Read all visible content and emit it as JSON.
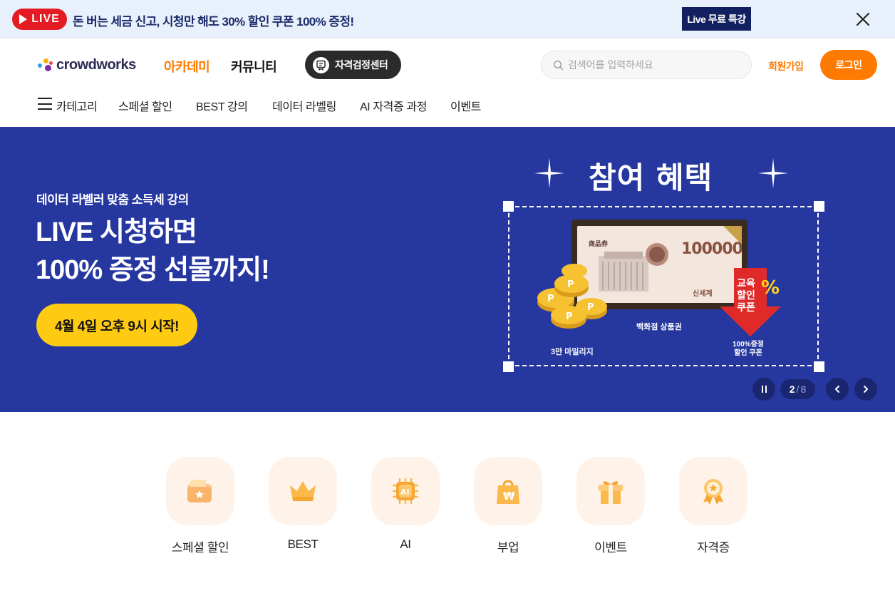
{
  "promo": {
    "live_label": "LIVE",
    "text": "돈 버는 세금 신고, 시청만 해도 30% 할인 쿠폰 100% 증정!",
    "button_label": "Live 무료 특강"
  },
  "header": {
    "logo_text": "crowdworks",
    "nav": [
      "아카데미",
      "커뮤니티"
    ],
    "cert_button_label": "자격검정센터",
    "search_placeholder": "검색어를 입력하세요",
    "signup_label": "회원가입",
    "login_label": "로그인"
  },
  "subnav": {
    "category_label": "카테고리",
    "items": [
      "스페셜 할인",
      "BEST 강의",
      "데이터 라벨링",
      "AI 자격증 과정",
      "이벤트"
    ]
  },
  "hero": {
    "subtitle": "데이터 라벨러 맞춤 소득세 강의",
    "title_line1": "LIVE 시청하면",
    "title_line2": "100% 증정 선물까지!",
    "cta_label": "4월 4일 오후 9시 시작!",
    "benefit_title": "참여 혜택",
    "voucher_label": "商品券",
    "voucher_amount": "100000",
    "voucher_brand": "신세계",
    "voucher_caption": "백화점 상품권",
    "mileage_caption": "3만 마일리지",
    "coupon_badge_line1": "교육",
    "coupon_badge_line2": "할인",
    "coupon_badge_line3": "쿠폰",
    "coupon_caption_line1": "100%증정",
    "coupon_caption_line2": "할인 쿠폰",
    "carousel_current": "2",
    "carousel_separator": "/",
    "carousel_total": "8"
  },
  "categories": [
    {
      "label": "스페셜 할인",
      "icon": "wallet-star-icon"
    },
    {
      "label": "BEST",
      "icon": "crown-icon"
    },
    {
      "label": "AI",
      "icon": "ai-chip-icon"
    },
    {
      "label": "부업",
      "icon": "shopping-bag-won-icon"
    },
    {
      "label": "이벤트",
      "icon": "gift-icon"
    },
    {
      "label": "자격증",
      "icon": "award-medal-icon"
    }
  ],
  "colors": {
    "accent": "#ff7a00",
    "hero_bg": "#2638a0",
    "live_red": "#e51b23",
    "cta_yellow": "#ffcb12",
    "promo_bg": "#e8f1fb"
  }
}
